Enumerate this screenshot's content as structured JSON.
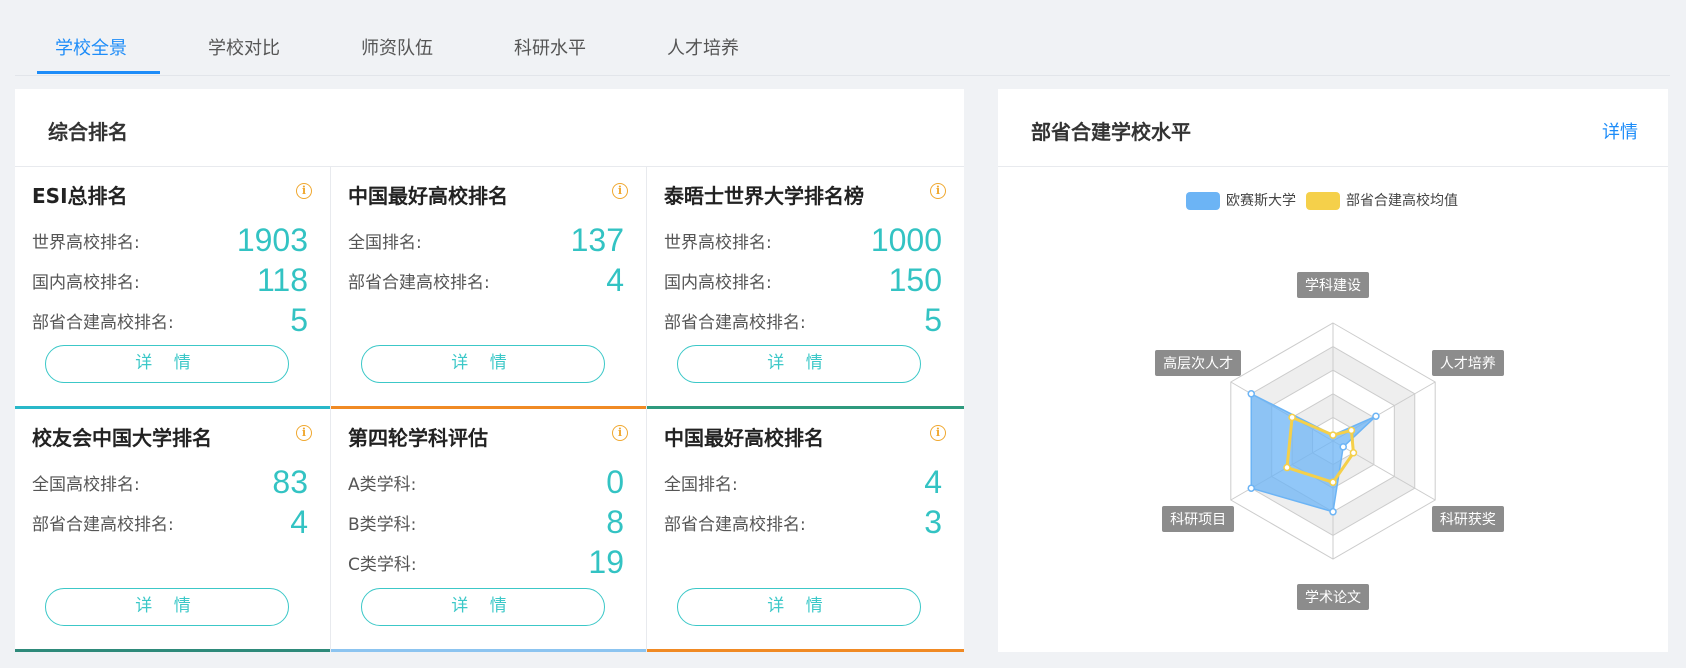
{
  "tabs": [
    {
      "label": "学校全景",
      "active": true
    },
    {
      "label": "学校对比",
      "active": false
    },
    {
      "label": "师资队伍",
      "active": false
    },
    {
      "label": "科研水平",
      "active": false
    },
    {
      "label": "人才培养",
      "active": false
    }
  ],
  "left": {
    "title": "综合排名",
    "detail_label": "详 情",
    "cards": [
      {
        "title": "ESI总排名",
        "rows": [
          {
            "label": "世界高校排名:",
            "value": "1903"
          },
          {
            "label": "国内高校排名:",
            "value": "118"
          },
          {
            "label": "部省合建高校排名:",
            "value": "5"
          }
        ],
        "bar_color": "#29b8c9"
      },
      {
        "title": "中国最好高校排名",
        "rows": [
          {
            "label": "全国排名:",
            "value": "137"
          },
          {
            "label": "部省合建高校排名:",
            "value": "4"
          }
        ],
        "bar_color": "#f08a24"
      },
      {
        "title": "泰晤士世界大学排名榜",
        "rows": [
          {
            "label": "世界高校排名:",
            "value": "1000"
          },
          {
            "label": "国内高校排名:",
            "value": "150"
          },
          {
            "label": "部省合建高校排名:",
            "value": "5"
          }
        ],
        "bar_color": "#2e9a7e"
      },
      {
        "title": "校友会中国大学排名",
        "rows": [
          {
            "label": "全国高校排名:",
            "value": "83"
          },
          {
            "label": "部省合建高校排名:",
            "value": "4"
          }
        ],
        "bar_color": "#2e8a7a"
      },
      {
        "title": "第四轮学科评估",
        "rows": [
          {
            "label": "A类学科:",
            "value": "0"
          },
          {
            "label": "B类学科:",
            "value": "8"
          },
          {
            "label": "C类学科:",
            "value": "19"
          }
        ],
        "bar_color": "#8cc4f0"
      },
      {
        "title": "中国最好高校排名",
        "rows": [
          {
            "label": "全国排名:",
            "value": "4"
          },
          {
            "label": "部省合建高校排名:",
            "value": "3"
          }
        ],
        "bar_color": "#f08a24"
      }
    ]
  },
  "right": {
    "title": "部省合建学校水平",
    "detail_label": "详情",
    "legend": [
      {
        "name": "欧赛斯大学",
        "color": "#6cb4f5"
      },
      {
        "name": "部省合建高校均值",
        "color": "#f5d04a"
      }
    ],
    "radar": {
      "axes": [
        "学科建设",
        "人才培养",
        "科研获奖",
        "学术论文",
        "科研项目",
        "高层次人才"
      ],
      "max": 100,
      "series": [
        {
          "name": "欧赛斯大学",
          "values": [
            5,
            42,
            10,
            60,
            80,
            80
          ],
          "color": "#6cb4f5"
        },
        {
          "name": "部省合建高校均值",
          "values": [
            5,
            18,
            20,
            35,
            45,
            40
          ],
          "color": "#f5d04a"
        }
      ]
    }
  }
}
